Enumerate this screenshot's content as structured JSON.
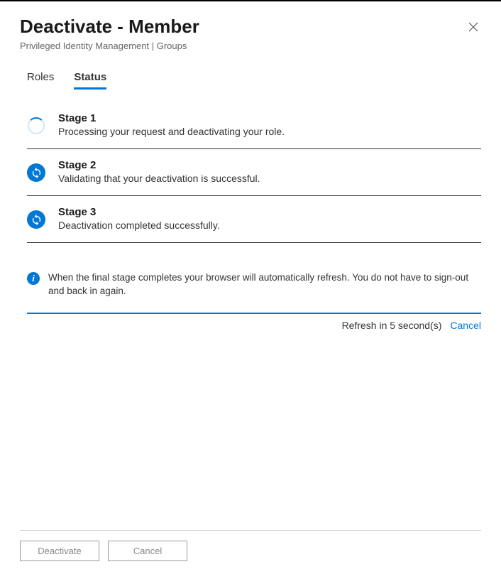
{
  "header": {
    "title": "Deactivate - Member",
    "breadcrumb": "Privileged Identity Management | Groups"
  },
  "tabs": [
    {
      "label": "Roles",
      "active": false
    },
    {
      "label": "Status",
      "active": true
    }
  ],
  "stages": [
    {
      "icon": "spinner",
      "title": "Stage 1",
      "description": "Processing your request and deactivating your role."
    },
    {
      "icon": "sync",
      "title": "Stage 2",
      "description": "Validating that your deactivation is successful."
    },
    {
      "icon": "sync",
      "title": "Stage 3",
      "description": "Deactivation completed successfully."
    }
  ],
  "info": {
    "text": "When the final stage completes your browser will automatically refresh. You do not have to sign-out and back in again."
  },
  "refresh": {
    "text": "Refresh in 5 second(s)",
    "cancel_label": "Cancel"
  },
  "footer": {
    "deactivate_label": "Deactivate",
    "cancel_label": "Cancel"
  }
}
